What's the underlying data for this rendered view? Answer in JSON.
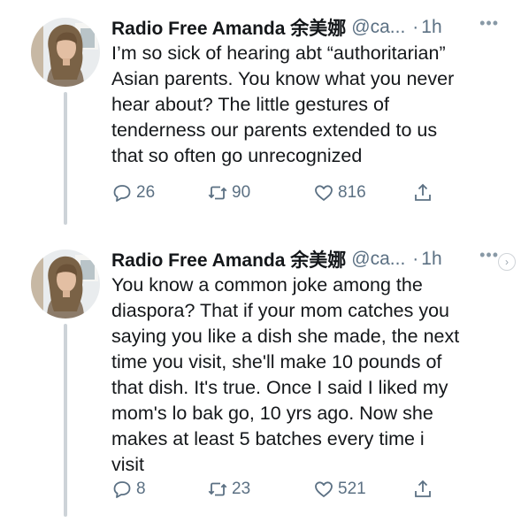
{
  "tweets": [
    {
      "author_name": "Radio Free Amanda 余美娜",
      "handle": "@ca...",
      "separator": "·",
      "time": "1h",
      "more_label": "•••",
      "text": "I’m so sick of hearing abt “authoritarian”\nAsian parents. You know what you never\nhear about? The little gestures of\ntenderness our parents extended to us\nthat so often go unrecognized",
      "reply_count": "26",
      "retweet_count": "90",
      "like_count": "816",
      "avatar_icon": "profile-photo"
    },
    {
      "author_name": "Radio Free Amanda 余美娜",
      "handle": "@ca...",
      "separator": "·",
      "time": "1h",
      "more_label": "•••",
      "text": "You know a common joke among the\ndiaspora? That if your mom catches you\nsaying you like a dish she made, the next\ntime you visit, she'll make 10 pounds of\nthat dish. It's true. Once I said I liked my\nmom's lo bak go, 10 yrs ago. Now she\nmakes at least 5 batches every time i\nvisit",
      "reply_count": "8",
      "retweet_count": "23",
      "like_count": "521",
      "avatar_icon": "profile-photo"
    }
  ],
  "icons": {
    "reply": "speech-bubble-icon",
    "retweet": "retweet-arrows-icon",
    "like": "heart-outline-icon",
    "share": "share-upload-icon",
    "scroll": "chevron-right-icon"
  },
  "scroll_glyph": "›",
  "colors": {
    "text": "#14171a",
    "secondary": "#5b7083",
    "thread_line": "#cdd3d8",
    "background": "#ffffff"
  }
}
